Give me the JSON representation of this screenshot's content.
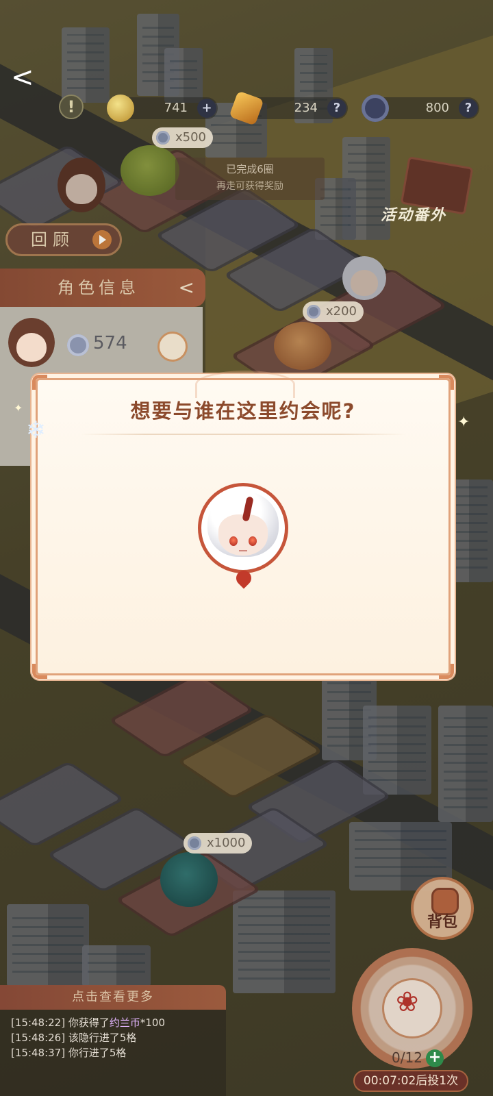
{
  "hud": {
    "resources": [
      {
        "name": "coin",
        "value": "741",
        "action_icon": "plus-icon",
        "action": "+"
      },
      {
        "name": "crystal",
        "value": "234",
        "action_icon": "help-icon",
        "action": "?"
      },
      {
        "name": "energy",
        "value": "800",
        "action_icon": "help-icon",
        "action": "?"
      }
    ],
    "warning": "!",
    "back_icon": "back-arrow-icon",
    "back_glyph": "<"
  },
  "board": {
    "goal_line1": "已完成6圈",
    "goal_line2": "再走可获得奖励",
    "costs": [
      "x500",
      "x200",
      "x1000"
    ],
    "event_label": "活动番外",
    "review_label": "回顾"
  },
  "char_panel": {
    "title": "角色信息",
    "collapse_glyph": "<",
    "coins": "574"
  },
  "modal": {
    "title": "想要与谁在这里约会呢?",
    "character_icon": "white-hair-character-avatar"
  },
  "log": {
    "header": "点击查看更多",
    "entries": [
      {
        "time": "[15:48:22]",
        "text": "你获得了",
        "em": "约兰币",
        "suffix": "*100"
      },
      {
        "time": "[15:48:26]",
        "text": "该隐行进了5格",
        "em": "",
        "suffix": ""
      },
      {
        "time": "[15:48:37]",
        "text": "你行进了5格",
        "em": "",
        "suffix": ""
      }
    ]
  },
  "bottom": {
    "bag_label": "背包",
    "dice_count": "0/12",
    "dice_plus": "+",
    "timer": "00:07:02后投1次"
  },
  "colors": {
    "accent": "#8c4a2c",
    "modal_border": "#e0a27a",
    "log_header": "#a45e40"
  }
}
